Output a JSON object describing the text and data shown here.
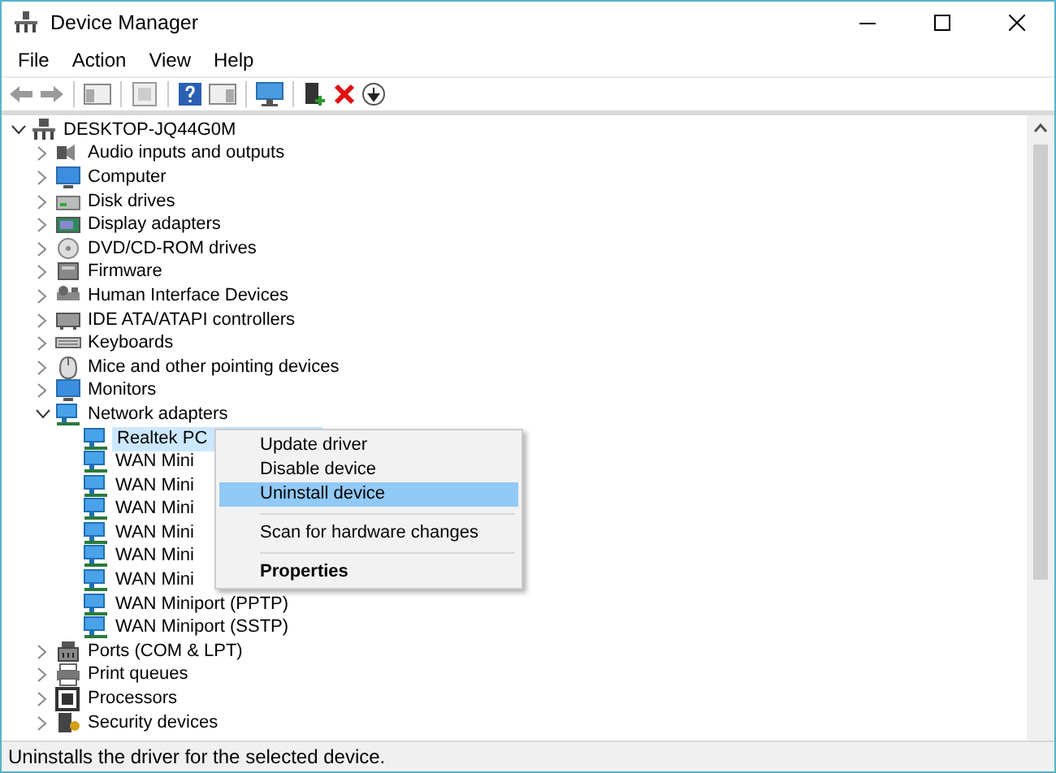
{
  "window": {
    "title": "Device Manager"
  },
  "menu_bar": [
    "File",
    "Action",
    "View",
    "Help"
  ],
  "tree": [
    {
      "label": "DESKTOP-JQ44G0M",
      "expanded": true,
      "selected": false,
      "children": [
        {
          "label": "Audio inputs and outputs",
          "expanded": false,
          "selected": false
        },
        {
          "label": "Computer",
          "expanded": false,
          "selected": false
        },
        {
          "label": "Disk drives",
          "expanded": false,
          "selected": false
        },
        {
          "label": "Display adapters",
          "expanded": false,
          "selected": false
        },
        {
          "label": "DVD/CD-ROM drives",
          "expanded": false,
          "selected": false
        },
        {
          "label": "Firmware",
          "expanded": false,
          "selected": false
        },
        {
          "label": "Human Interface Devices",
          "expanded": false,
          "selected": false
        },
        {
          "label": "IDE ATA/ATAPI controllers",
          "expanded": false,
          "selected": false
        },
        {
          "label": "Keyboards",
          "expanded": false,
          "selected": false
        },
        {
          "label": "Mice and other pointing devices",
          "expanded": false,
          "selected": false
        },
        {
          "label": "Monitors",
          "expanded": false,
          "selected": false
        },
        {
          "label": "Network adapters",
          "expanded": true,
          "selected": false,
          "children": [
            {
              "label": "Realtek PC",
              "selected": true
            },
            {
              "label": "WAN Mini",
              "selected": false
            },
            {
              "label": "WAN Mini",
              "selected": false
            },
            {
              "label": "WAN Mini",
              "selected": false
            },
            {
              "label": "WAN Mini",
              "selected": false
            },
            {
              "label": "WAN Mini",
              "selected": false
            },
            {
              "label": "WAN Mini",
              "selected": false
            },
            {
              "label": "WAN Miniport (PPTP)",
              "selected": false
            },
            {
              "label": "WAN Miniport (SSTP)",
              "selected": false
            }
          ]
        },
        {
          "label": "Ports (COM & LPT)",
          "expanded": false,
          "selected": false
        },
        {
          "label": "Print queues",
          "expanded": false,
          "selected": false
        },
        {
          "label": "Processors",
          "expanded": false,
          "selected": false
        },
        {
          "label": "Security devices",
          "expanded": false,
          "selected": false
        }
      ]
    }
  ],
  "context_menu": [
    {
      "kind": "item",
      "label": "Update driver",
      "selected": false
    },
    {
      "kind": "item",
      "label": "Disable device",
      "selected": false
    },
    {
      "kind": "item",
      "label": "Uninstall device",
      "selected": true
    },
    {
      "kind": "separator"
    },
    {
      "kind": "item",
      "label": "Scan for hardware changes",
      "selected": false
    },
    {
      "kind": "separator"
    },
    {
      "kind": "default",
      "label": "Properties",
      "selected": false
    }
  ],
  "status_bar": "Uninstalls the driver for the selected device."
}
